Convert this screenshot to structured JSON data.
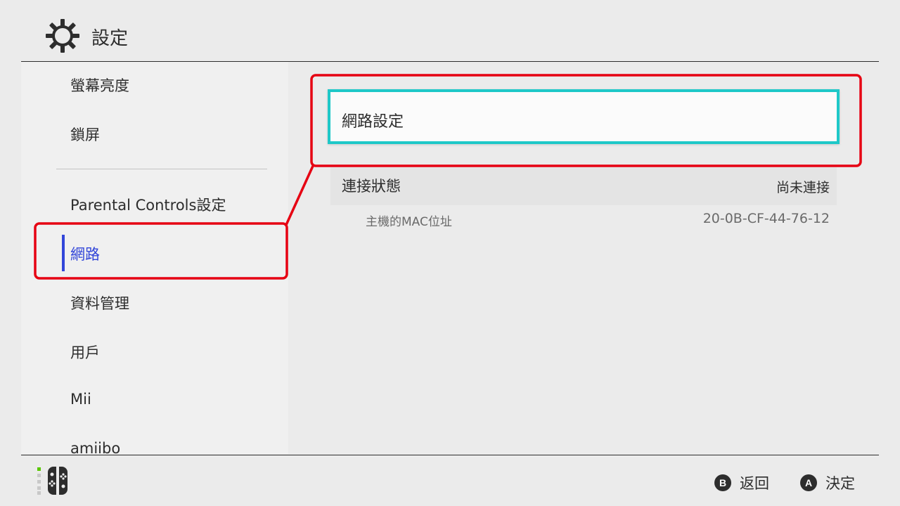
{
  "header": {
    "title": "設定",
    "icon": "gear-icon"
  },
  "sidebar": {
    "items": [
      {
        "label": "螢幕亮度"
      },
      {
        "label": "鎖屏"
      },
      {
        "label": "Parental Controls設定"
      },
      {
        "label": "網路",
        "active": true
      },
      {
        "label": "資料管理"
      },
      {
        "label": "用戶"
      },
      {
        "label": "Mii"
      },
      {
        "label": "amiibo"
      }
    ]
  },
  "main": {
    "network_settings_label": "網路設定",
    "connection_status": {
      "label": "連接狀態",
      "value": "尚未連接"
    },
    "mac_address": {
      "label": "主機的MAC位址",
      "value": "20-0B-CF-44-76-12"
    }
  },
  "footer": {
    "controller_icon": "joy-con-icon",
    "hints": [
      {
        "button": "B",
        "label": "返回"
      },
      {
        "button": "A",
        "label": "決定"
      }
    ]
  },
  "colors": {
    "accent_active": "#3246d9",
    "selection_border": "#1ec8c8",
    "annotation_red": "#e60012",
    "background": "#ebebeb"
  }
}
